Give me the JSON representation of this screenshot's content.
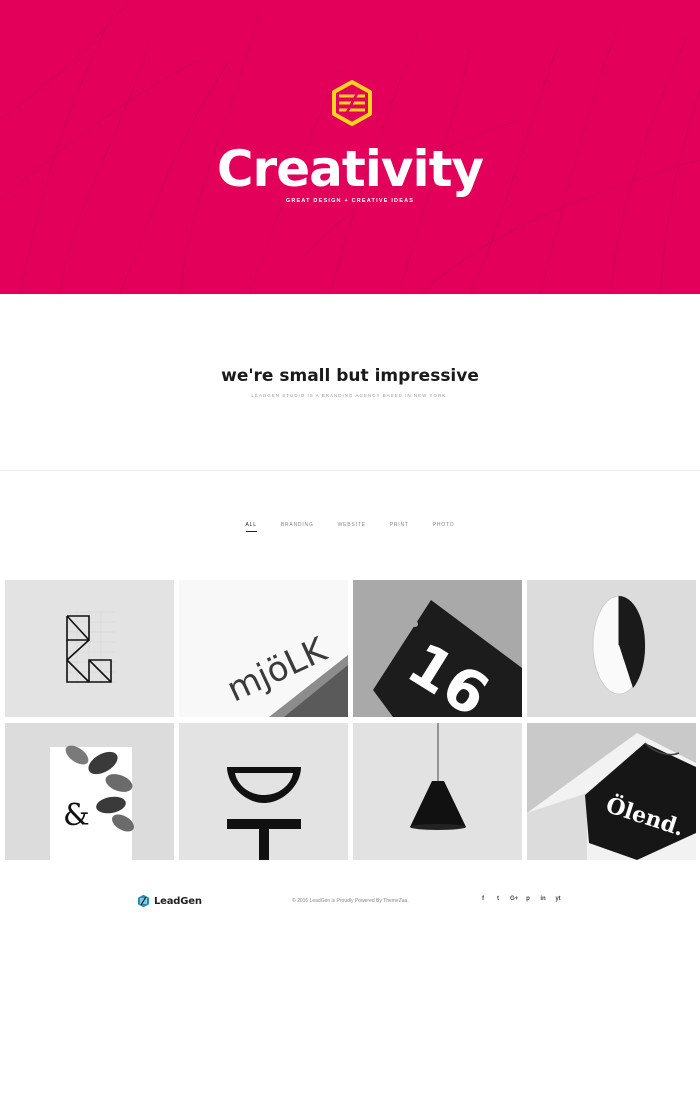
{
  "hero": {
    "title": "Creativity",
    "tagline": "GREAT DESIGN + CREATIVE IDEAS",
    "background_color": "#e2005a",
    "logo_color": "#f5d61c"
  },
  "intro": {
    "headline": "we're small but impressive",
    "subline": "LEADGEN STUDIO IS A BRANDING AGENCY BASED IN NEW YORK."
  },
  "filters": [
    {
      "label": "All",
      "active": true
    },
    {
      "label": "BRANDING",
      "active": false
    },
    {
      "label": "WEBSITE",
      "active": false
    },
    {
      "label": "PRINT",
      "active": false
    },
    {
      "label": "PHOTO",
      "active": false
    }
  ],
  "portfolio": {
    "items": [
      {
        "name": "geometric-letter-sketch"
      },
      {
        "name": "mjolk-business-card",
        "text": "mjöLK"
      },
      {
        "name": "number-16-tag",
        "text": "16"
      },
      {
        "name": "half-circle-object"
      },
      {
        "name": "ampersand-botanical-print",
        "text": "&"
      },
      {
        "name": "abstract-letterform"
      },
      {
        "name": "black-pendant-lamp"
      },
      {
        "name": "olend-black-tshirt",
        "text": "Ölend."
      }
    ]
  },
  "footer": {
    "brand": "LeadGen",
    "copyright": "© 2016 LeadGen is Proudly Powered By ThemeZaa.",
    "social": [
      {
        "icon": "facebook-icon",
        "glyph": "f"
      },
      {
        "icon": "twitter-icon",
        "glyph": "t"
      },
      {
        "icon": "google-plus-icon",
        "glyph": "G+"
      },
      {
        "icon": "pinterest-icon",
        "glyph": "p"
      },
      {
        "icon": "linkedin-icon",
        "glyph": "in"
      },
      {
        "icon": "youtube-icon",
        "glyph": "yt"
      }
    ]
  }
}
